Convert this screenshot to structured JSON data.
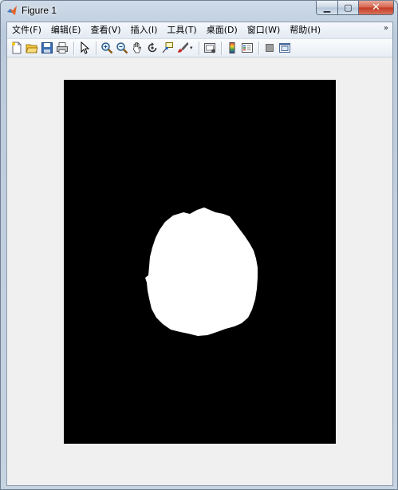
{
  "window": {
    "title": "Figure 1",
    "minimize_label": "▁",
    "maximize_label": "▢",
    "close_label": "✕"
  },
  "menu": {
    "items": [
      "文件(F)",
      "编辑(E)",
      "查看(V)",
      "插入(I)",
      "工具(T)",
      "桌面(D)",
      "窗口(W)",
      "帮助(H)"
    ],
    "more_glyph": "»"
  },
  "toolbar": {
    "buttons": [
      "new-figure-icon",
      "open-file-icon",
      "save-icon",
      "print-icon",
      "edit-plot-arrow-icon",
      "zoom-in-icon",
      "zoom-out-icon",
      "pan-hand-icon",
      "rotate-3d-icon",
      "data-cursor-icon",
      "brush-icon",
      "link-plot-icon",
      "insert-colorbar-icon",
      "insert-legend-icon",
      "hide-plot-tools-icon",
      "show-plot-tools-icon"
    ],
    "dropdown_glyph": "▾"
  },
  "figure": {
    "background": "#000000",
    "blob_color": "#ffffff"
  }
}
